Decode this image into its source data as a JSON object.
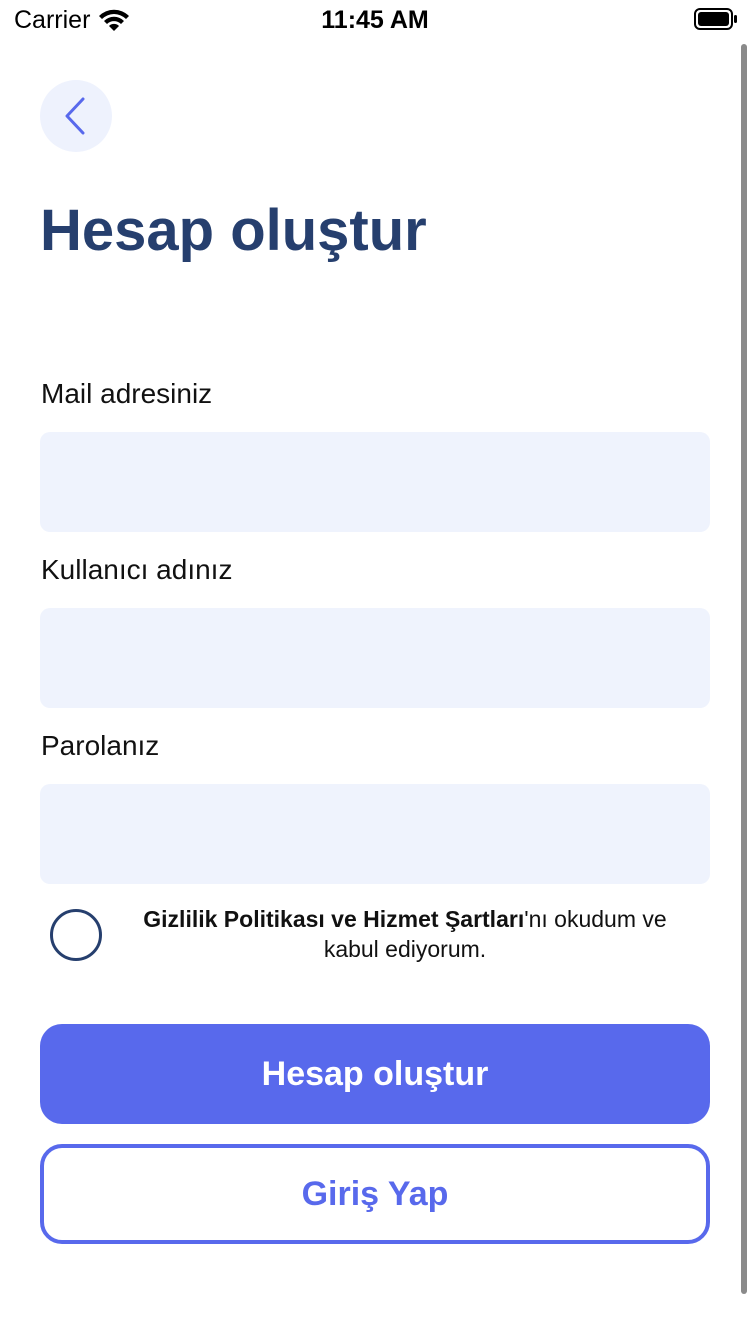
{
  "status_bar": {
    "carrier": "Carrier",
    "time": "11:45 AM"
  },
  "header": {
    "back_icon": "chevron-left-icon",
    "title": "Hesap oluştur"
  },
  "form": {
    "email_label": "Mail adresiniz",
    "email_value": "",
    "username_label": "Kullanıcı adınız",
    "username_value": "",
    "password_label": "Parolanız",
    "password_value": ""
  },
  "terms": {
    "checked": false,
    "link_text": "Gizlilik Politikası ve Hizmet Şartları",
    "suffix_text": "'nı okudum ve kabul ediyorum."
  },
  "actions": {
    "create_account_label": "Hesap oluştur",
    "login_label": "Giriş Yap"
  },
  "colors": {
    "title": "#263f6e",
    "accent": "#5869ec",
    "input_background": "#eff3fd",
    "back_button_background": "#eef2fd"
  }
}
